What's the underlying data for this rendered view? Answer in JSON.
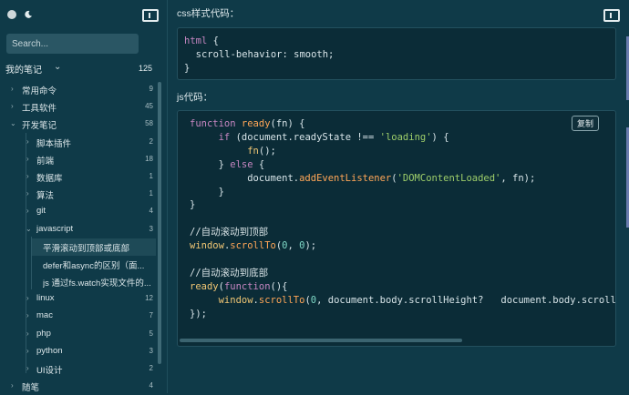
{
  "sidebar": {
    "search_placeholder": "Search...",
    "notes_title": "我的笔记",
    "notes_count": "125",
    "items": [
      {
        "label": "常用命令",
        "count": "9"
      },
      {
        "label": "工具软件",
        "count": "45"
      },
      {
        "label": "开发笔记",
        "count": "58"
      },
      {
        "label": "脚本插件",
        "count": "2"
      },
      {
        "label": "前端",
        "count": "18"
      },
      {
        "label": "数据库",
        "count": "1"
      },
      {
        "label": "算法",
        "count": "1"
      },
      {
        "label": "git",
        "count": "4"
      },
      {
        "label": "javascript",
        "count": "3"
      },
      {
        "label": "平滑滚动到顶部或底部",
        "count": ""
      },
      {
        "label": "defer和async的区别（面...",
        "count": ""
      },
      {
        "label": "js 通过fs.watch实现文件的...",
        "count": ""
      },
      {
        "label": "linux",
        "count": "12"
      },
      {
        "label": "mac",
        "count": "7"
      },
      {
        "label": "php",
        "count": "5"
      },
      {
        "label": "python",
        "count": "3"
      },
      {
        "label": "UI设计",
        "count": "2"
      },
      {
        "label": "随笔",
        "count": "4"
      }
    ]
  },
  "main": {
    "css_label": "css样式代码：",
    "js_label": "js代码：",
    "copy_label": "复制"
  },
  "icons": {
    "theme": "moon-icon",
    "panel": "sidebar-toggle-icon",
    "chevron": "chevron-icon"
  }
}
